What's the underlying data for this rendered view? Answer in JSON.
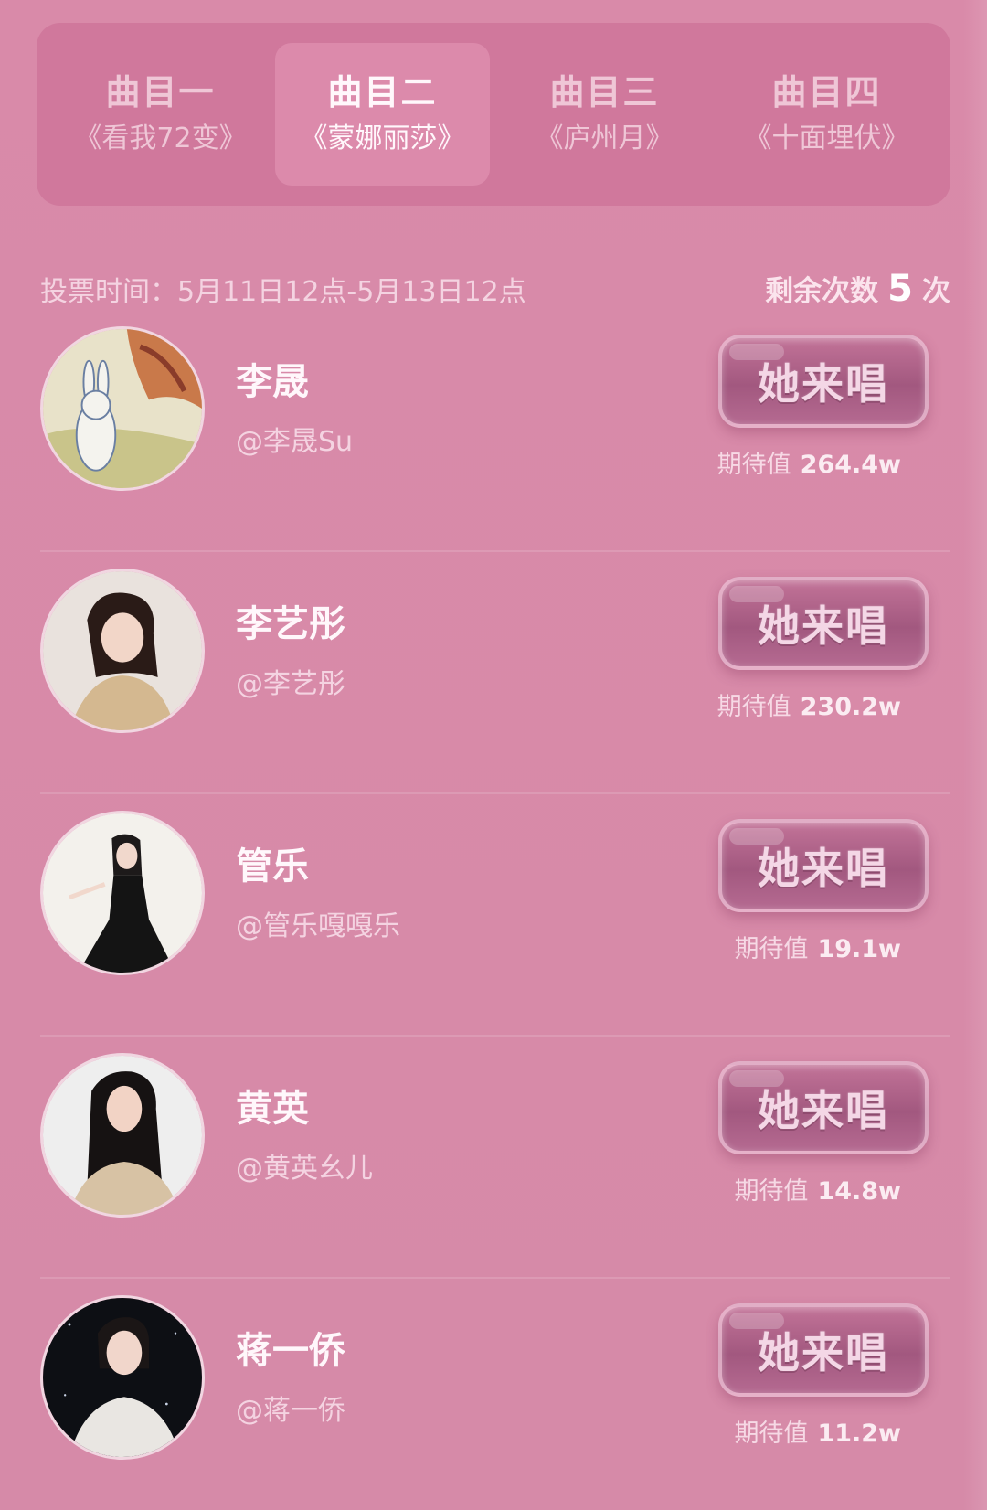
{
  "tabs": [
    {
      "title": "曲目一",
      "song": "《看我72变》",
      "active": false
    },
    {
      "title": "曲目二",
      "song": "《蒙娜丽莎》",
      "active": true
    },
    {
      "title": "曲目三",
      "song": "《庐州月》",
      "active": false
    },
    {
      "title": "曲目四",
      "song": "《十面埋伏》",
      "active": false
    }
  ],
  "vote": {
    "time_text": "投票时间：5月11日12点-5月13日12点",
    "remaining_label": "剩余次数",
    "remaining_count": "5",
    "remaining_unit": "次"
  },
  "candidates": [
    {
      "name": "李晟",
      "handle": "@李晟Su",
      "button": "她来唱",
      "expect_label": "期待值",
      "expect_value": "264.4w",
      "avatar": "rabbit-illustration"
    },
    {
      "name": "李艺彤",
      "handle": "@李艺彤",
      "button": "她来唱",
      "expect_label": "期待值",
      "expect_value": "230.2w",
      "avatar": "portrait"
    },
    {
      "name": "管乐",
      "handle": "@管乐嘎嘎乐",
      "button": "她来唱",
      "expect_label": "期待值",
      "expect_value": "19.1w",
      "avatar": "portrait"
    },
    {
      "name": "黄英",
      "handle": "@黄英幺儿",
      "button": "她来唱",
      "expect_label": "期待值",
      "expect_value": "14.8w",
      "avatar": "portrait"
    },
    {
      "name": "蒋一侨",
      "handle": "@蒋一侨",
      "button": "她来唱",
      "expect_label": "期待值",
      "expect_value": "11.2w",
      "avatar": "portrait-dark"
    }
  ],
  "colors": {
    "background": "#d889a8",
    "tab_bar": "#c8699199",
    "button": "#a2587f"
  }
}
